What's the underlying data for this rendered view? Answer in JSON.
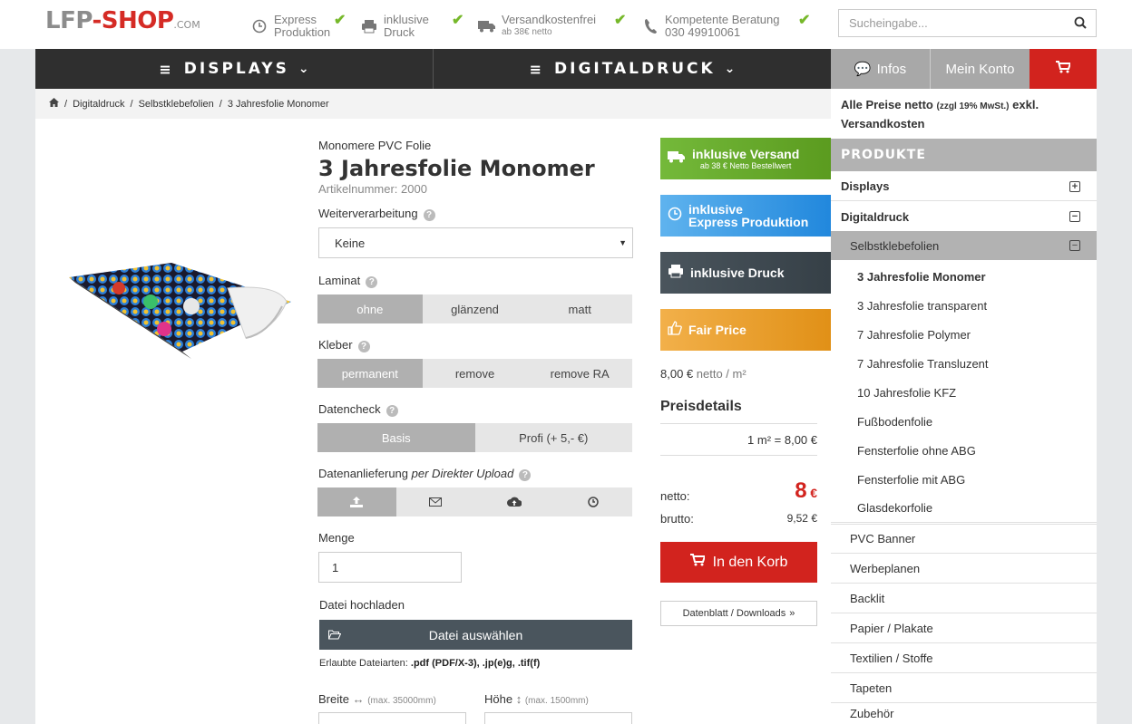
{
  "header": {
    "logo_a": "LFP",
    "logo_b": "-SHOP",
    "logo_c": ".COM",
    "features": [
      {
        "icon": "clock-icon",
        "line1": "Express",
        "line2": "Produktion"
      },
      {
        "icon": "printer-icon",
        "line1": "inklusive",
        "line2": "Druck"
      },
      {
        "icon": "truck-icon",
        "line1": "Versandkostenfrei",
        "line2": "ab 38€ netto"
      },
      {
        "icon": "phone-icon",
        "line1": "Kompetente Beratung",
        "line2": "030 49910061"
      }
    ],
    "search_placeholder": "Sucheingabe..."
  },
  "nav": {
    "displays": "DISPLAYS",
    "digitaldruck": "DIGITALDRUCK",
    "info": "Infos",
    "konto": "Mein Konto"
  },
  "breadcrumb": [
    "Digitaldruck",
    "Selbstklebefolien",
    "3 Jahresfolie Monomer"
  ],
  "product": {
    "subtitle": "Monomere PVC Folie",
    "title": "3 Jahresfolie Monomer",
    "artnr": "Artikelnummer: 2000",
    "weiter_label": "Weiterverarbeitung",
    "weiter_value": "Keine",
    "laminat_label": "Laminat",
    "laminat_options": [
      "ohne",
      "glänzend",
      "matt"
    ],
    "kleber_label": "Kleber",
    "kleber_options": [
      "permanent",
      "remove",
      "remove RA"
    ],
    "datencheck_label": "Datencheck",
    "datencheck_options": [
      "Basis",
      "Profi (+ 5,- €)"
    ],
    "datenanlieferung_label": "Datenanlieferung",
    "datenanlieferung_mode": "per Direkter Upload",
    "menge_label": "Menge",
    "menge_value": "1",
    "upload_label": "Datei hochladen",
    "upload_button": "Datei auswählen",
    "allowed_prefix": "Erlaubte Dateiarten:",
    "allowed_types": ".pdf (PDF/X-3), .jp(e)g, .tif(f)",
    "breite_label": "Breite",
    "breite_hint": "(max. 35000mm)",
    "hoehe_label": "Höhe",
    "hoehe_hint": "(max. 1500mm)"
  },
  "badges": {
    "versand": "inklusive Versand",
    "versand_sub": "ab 38 € Netto Bestellwert",
    "express1": "inklusive",
    "express2": "Express Produktion",
    "druck": "inklusive Druck",
    "fair": "Fair Price",
    "colors": {
      "green": "#6aac2a",
      "blue": "#2a93e0",
      "dark": "#3d474f",
      "orange": "#eb9a1f"
    }
  },
  "pricing": {
    "unit_price": "8,00 €",
    "unit_suffix": "netto / m²",
    "details_title": "Preisdetails",
    "line": "1 m² = 8,00 €",
    "netto_label": "netto:",
    "netto_value": "8",
    "netto_cur": "€",
    "brutto_label": "brutto:",
    "brutto_value": "9,52 €",
    "cart_button": "In den Korb",
    "downloads": "Datenblatt / Downloads"
  },
  "sidebar": {
    "note_a": "Alle Preise netto",
    "note_b": "(zzgl 19% MwSt.)",
    "note_c": "exkl. Versandkosten",
    "header": "PRODUKTE",
    "displays": "Displays",
    "digitaldruck": "Digitaldruck",
    "selbst": "Selbstklebefolien",
    "folien": [
      "3 Jahresfolie Monomer",
      "3 Jahresfolie transparent",
      "7 Jahresfolie Polymer",
      "7 Jahresfolie Transluzent",
      "10 Jahresfolie KFZ",
      "Fußbodenfolie",
      "Fensterfolie ohne ABG",
      "Fensterfolie mit ABG",
      "Glasdekorfolie"
    ],
    "others": [
      "PVC Banner",
      "Werbeplanen",
      "Backlit",
      "Papier / Plakate",
      "Textilien / Stoffe",
      "Tapeten",
      "Zubehör"
    ]
  }
}
